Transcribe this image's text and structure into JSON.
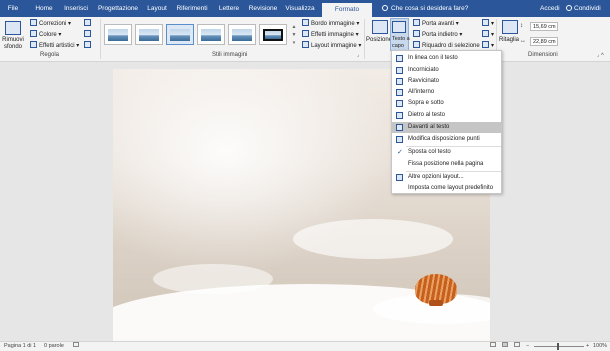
{
  "tabs": [
    "File",
    "Home",
    "Inserisci",
    "Progettazione",
    "Layout",
    "Riferimenti",
    "Lettere",
    "Revisione",
    "Visualizza",
    "Formato"
  ],
  "active_tab": "Formato",
  "tell_me": "Che cosa si desidera fare?",
  "sign_in": "Accedi",
  "share": "Condividi",
  "ribbon": {
    "remove_bg": "Rimuovi sfondo",
    "corrections": "Correzioni",
    "color": "Colore",
    "artistic": "Effetti artistici",
    "group_adjust": "Regola",
    "group_styles": "Stili immagini",
    "border": "Bordo immagine",
    "effects": "Effetti immagine",
    "layout": "Layout immagine",
    "position": "Posizione",
    "wrap_line1": "Testo a",
    "wrap_line2": "capo",
    "bring_forward": "Porta avanti",
    "send_backward": "Porta indietro",
    "selection_pane": "Riquadro di selezione",
    "crop": "Ritaglia",
    "height": "15,69 cm",
    "width": "22,89 cm",
    "group_size": "Dimensioni"
  },
  "menu": {
    "items": [
      "In linea con il testo",
      "Incorniciato",
      "Ravvicinato",
      "All'interno",
      "Sopra e sotto",
      "Dietro al testo",
      "Davanti al testo",
      "Modifica disposizione punti",
      "Sposta col testo",
      "Fissa posizione nella pagina",
      "Altre opzioni layout...",
      "Imposta come layout predefinito"
    ],
    "highlighted": "Davanti al testo",
    "checked": "Sposta col testo"
  },
  "status": {
    "page": "Pagina 1 di 1",
    "words": "0 parole",
    "zoom": "100%"
  }
}
